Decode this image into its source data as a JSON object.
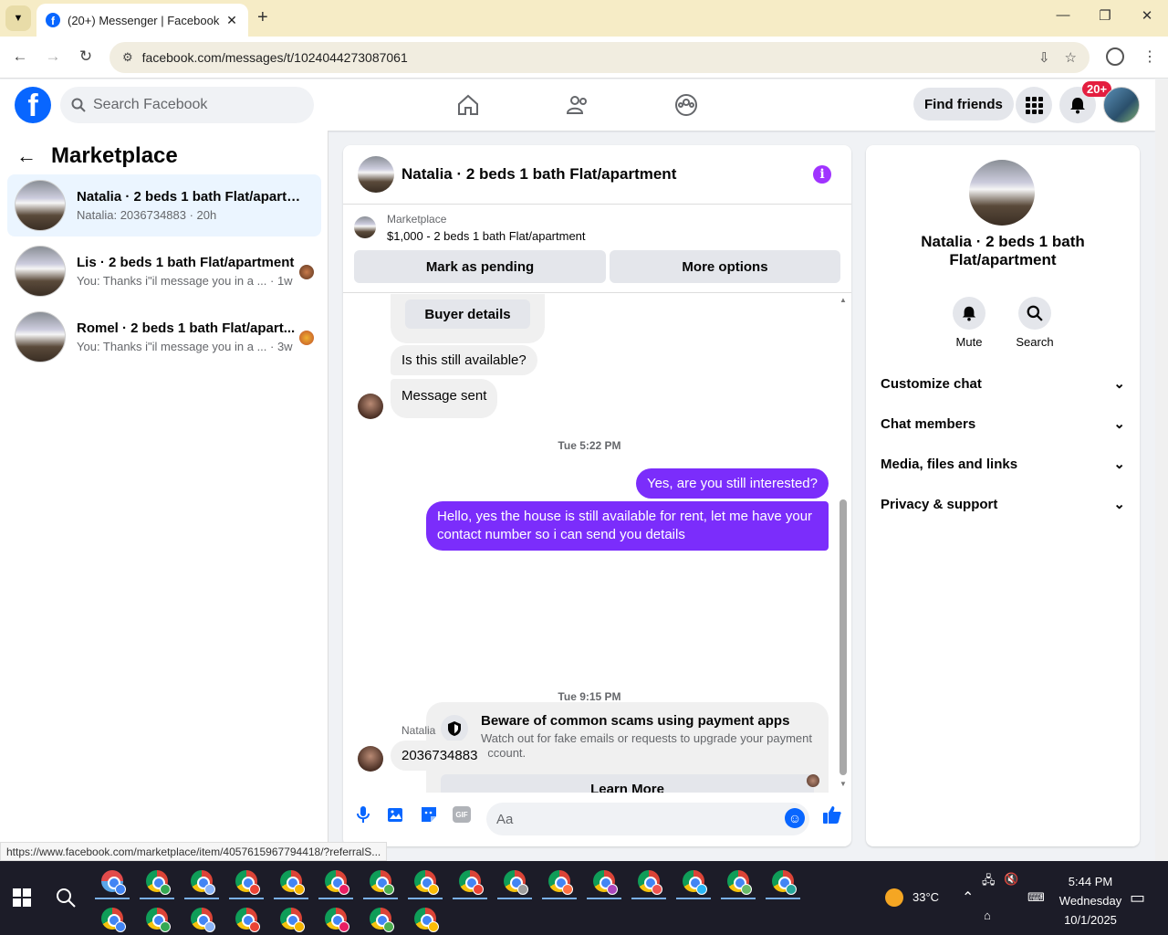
{
  "browser": {
    "tab_title": "(20+) Messenger | Facebook",
    "url": "facebook.com/messages/t/1024044273087061"
  },
  "fb": {
    "search_placeholder": "Search Facebook",
    "find_friends": "Find friends",
    "notif_badge": "20+"
  },
  "sidebar": {
    "title": "Marketplace",
    "conversations": [
      {
        "name": "Natalia · 2 beds 1 bath Flat/apartm...",
        "sub": "Natalia: 2036734883 · 20h"
      },
      {
        "name": "Lis · 2 beds 1 bath Flat/apartment",
        "sub": "You: Thanks i\"il message you in a ... · 1w"
      },
      {
        "name": "Romel · 2 beds 1 bath Flat/apart...",
        "sub": "You: Thanks i\"il message you in a ... · 3w"
      }
    ]
  },
  "chat": {
    "title": "Natalia · 2 beds 1 bath Flat/apartment",
    "listing_category": "Marketplace",
    "listing_price": "$1,000 - 2 beds 1 bath Flat/apartment",
    "mark_pending": "Mark as pending",
    "more_options": "More options",
    "messages": {
      "buyer_details": "Buyer details",
      "available_q": "Is this still available?",
      "message_sent": "Message sent",
      "ts1": "Tue 5:22 PM",
      "out1": "Yes, are you still interested?",
      "out2": "Hello, yes the house is still available for rent, let me have your contact number so i can send you details",
      "ts2": "Tue 9:15 PM",
      "sender": "Natalia",
      "in_number": "2036734883"
    },
    "scam": {
      "title": "Beware of common scams using payment apps",
      "desc": "Watch out for fake emails or requests to upgrade your payment account.",
      "button": "Learn More"
    },
    "composer_placeholder": "Aa",
    "gif_label": "GIF"
  },
  "details": {
    "name": "Natalia · 2 beds 1 bath Flat/apartment",
    "mute": "Mute",
    "search": "Search",
    "sections": [
      "Customize chat",
      "Chat members",
      "Media, files and links",
      "Privacy & support"
    ]
  },
  "status_url": "https://www.facebook.com/marketplace/item/4057615967794418/?referralS...",
  "taskbar": {
    "temp": "33°C",
    "time": "5:44 PM",
    "day": "Wednesday",
    "date": "10/1/2025"
  }
}
